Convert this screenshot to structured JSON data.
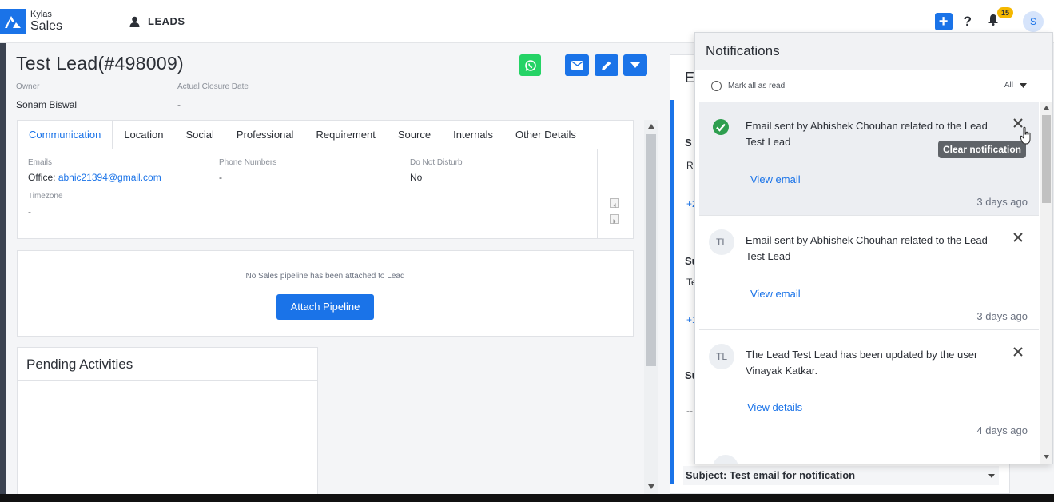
{
  "brand": {
    "line1": "Kylas",
    "line2": "Sales"
  },
  "module": {
    "label": "LEADS"
  },
  "header": {
    "notification_count": "15",
    "avatar_initial": "S",
    "plus_glyph": "+",
    "help_glyph": "?"
  },
  "lead": {
    "title": "Test Lead(#498009)",
    "owner_label": "Owner",
    "owner_value": "Sonam Biswal",
    "closure_label": "Actual Closure Date",
    "closure_value": "-"
  },
  "tabs": [
    "Communication",
    "Location",
    "Social",
    "Professional",
    "Requirement",
    "Source",
    "Internals",
    "Other Details"
  ],
  "communication": {
    "emails_label": "Emails",
    "emails_prefix": "Office:",
    "email": "abhic21394@gmail.com",
    "phone_label": "Phone Numbers",
    "phone_value": "-",
    "dnd_label": "Do Not Disturb",
    "dnd_value": "No",
    "timezone_label": "Timezone",
    "timezone_value": "-"
  },
  "pipeline": {
    "message": "No Sales pipeline has been attached to Lead",
    "button": "Attach Pipeline"
  },
  "pending": {
    "title": "Pending Activities"
  },
  "right_col": {
    "header_letter": "E",
    "row_texts": [
      "S",
      "Re",
      "+2",
      "Su",
      "Te",
      "+1",
      "Su",
      "--"
    ]
  },
  "notifications": {
    "title": "Notifications",
    "mark_all": "Mark all as read",
    "filter": "All",
    "tooltip": "Clear notification",
    "items": [
      {
        "avatar": "",
        "text": "Email sent by Abhishek Chouhan related to the Lead Test Lead",
        "link": "View email",
        "time": "3 days ago"
      },
      {
        "avatar": "TL",
        "text": "Email sent by Abhishek Chouhan related to the Lead Test Lead",
        "link": "View email",
        "time": "3 days ago"
      },
      {
        "avatar": "TL",
        "text": "The Lead Test Lead has been updated by the user Vinayak Katkar.",
        "link": "View details",
        "time": "4 days ago"
      }
    ]
  },
  "subject_bar": {
    "text": "Subject: Test email for notification"
  },
  "colors": {
    "primary": "#1a73e8",
    "whatsapp": "#25d366",
    "success": "#2e9e4f",
    "badge": "#f5b800"
  }
}
